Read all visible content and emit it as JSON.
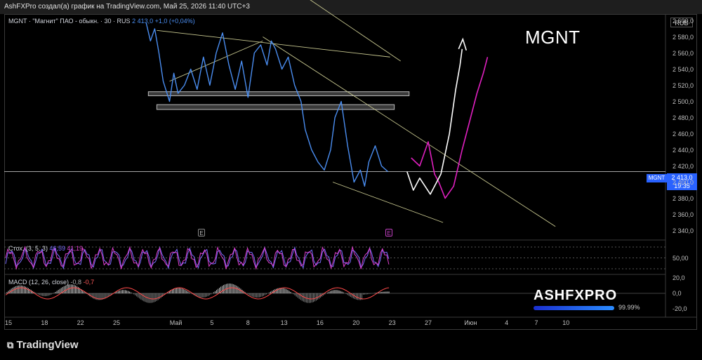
{
  "header": {
    "text": "AshFXPro создал(а) график на TradingView.com, Май 25, 2026 11:40 UTC+3"
  },
  "chart_title": "MGNT",
  "legend": {
    "text": "MGNT · \"Магнит\" ПАО - обыкн. · 30 · RUS",
    "price": "2 413,0",
    "change": "+1,0 (+0,04%)"
  },
  "currency_label": "RUB",
  "price_tag": {
    "symbol": "MGNT",
    "price": "2 413,0",
    "timer": "19:35"
  },
  "earnings_marker": "E",
  "stoch_label": {
    "name": "Стох. (3, 5, 3)",
    "k": "46,59",
    "d": "41,19"
  },
  "macd_label": {
    "name": "MACD (12, 26, close)",
    "v1": "-0,8",
    "v2": "-0,7"
  },
  "watermark": {
    "brand": "ASHFXPRO",
    "percent": "99.99%",
    "level": 0.9999
  },
  "footer": {
    "logo": "TradingView"
  },
  "colors": {
    "price": "#4a8df0",
    "projection_white": "#ffffff",
    "projection_magenta": "#e020c0",
    "trendline": "#c8c890",
    "stoch_k": "#e040d0",
    "stoch_d": "#7a6cff",
    "macd_pos": "#cccccc"
  },
  "chart_data": {
    "type": "line",
    "title": "MGNT",
    "ylim": [
      2330,
      2610
    ],
    "y_ticks": [
      "2 600,0",
      "2 580,0",
      "2 560,0",
      "2 540,0",
      "2 520,0",
      "2 500,0",
      "2 480,0",
      "2 460,0",
      "2 440,0",
      "2 420,0",
      "2 400,0",
      "2 380,0",
      "2 360,0",
      "2 340,0"
    ],
    "y_tick_values": [
      2600,
      2580,
      2560,
      2540,
      2520,
      2500,
      2480,
      2460,
      2440,
      2420,
      2400,
      2380,
      2360,
      2340
    ],
    "x_tick_labels": [
      "15",
      "18",
      "22",
      "25",
      "Май",
      "5",
      "8",
      "13",
      "16",
      "20",
      "23",
      "27",
      "Июн",
      "4",
      "7",
      "10"
    ],
    "x_tick_index": [
      0,
      17,
      34,
      51,
      79,
      96,
      113,
      130,
      147,
      164,
      181,
      198,
      218,
      235,
      249,
      263
    ],
    "price_series": {
      "name": "MGNT",
      "index": [
        65,
        67,
        69,
        71,
        73,
        76,
        78,
        80,
        83,
        86,
        89,
        92,
        95,
        98,
        101,
        104,
        107,
        110,
        113,
        116,
        119,
        122,
        124,
        126,
        129,
        132,
        135,
        138,
        140,
        143,
        146,
        149,
        152,
        154,
        157,
        160,
        163,
        166,
        168,
        170,
        173,
        176,
        179
      ],
      "values": [
        2597,
        2575,
        2590,
        2560,
        2525,
        2500,
        2535,
        2510,
        2520,
        2540,
        2515,
        2555,
        2520,
        2560,
        2585,
        2545,
        2515,
        2550,
        2505,
        2560,
        2570,
        2545,
        2575,
        2565,
        2540,
        2555,
        2520,
        2500,
        2465,
        2440,
        2425,
        2415,
        2440,
        2480,
        2500,
        2445,
        2400,
        2415,
        2395,
        2425,
        2445,
        2420,
        2413
      ]
    },
    "projection_white": {
      "index": [
        188,
        191,
        194,
        199,
        204,
        208,
        211,
        213,
        214
      ],
      "values": [
        2413,
        2390,
        2405,
        2385,
        2410,
        2460,
        2515,
        2545,
        2565
      ]
    },
    "projection_magenta": {
      "index": [
        190,
        194,
        198,
        201,
        203,
        206,
        210,
        214,
        218,
        221,
        224,
        226
      ],
      "values": [
        2430,
        2420,
        2450,
        2410,
        2400,
        2380,
        2395,
        2440,
        2480,
        2510,
        2535,
        2555
      ]
    },
    "trendlines": [
      {
        "x1": 70,
        "y1": 2588,
        "x2": 180,
        "y2": 2555
      },
      {
        "x1": 120,
        "y1": 2580,
        "x2": 258,
        "y2": 2345
      },
      {
        "x1": 140,
        "y1": 2630,
        "x2": 185,
        "y2": 2550
      },
      {
        "x1": 153,
        "y1": 2400,
        "x2": 205,
        "y2": 2350
      },
      {
        "x1": 76,
        "y1": 2525,
        "x2": 120,
        "y2": 2575
      }
    ],
    "zones": [
      {
        "x1": 66,
        "x2": 189,
        "y_top": 2512,
        "y_bottom": 2507
      },
      {
        "x1": 70,
        "x2": 182,
        "y_top": 2496,
        "y_bottom": 2490
      }
    ],
    "horizontal_line": 2413,
    "stoch_levels": [
      80,
      50,
      20
    ],
    "stoch_tick_labels": [
      "50,00"
    ],
    "macd_tick_labels": [
      "20,0",
      "0,0",
      "-20,0"
    ],
    "macd_tick_values": [
      20,
      0,
      -20
    ]
  }
}
